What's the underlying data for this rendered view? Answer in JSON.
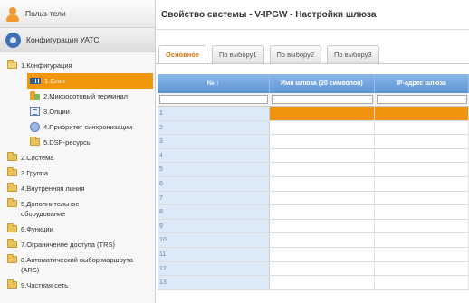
{
  "sidebar": {
    "top_users": "Польз-тели",
    "top_config": "Конфигурация УАТС",
    "tree": [
      {
        "label": "1.Конфигурация",
        "kind": "folder-open",
        "level": 0
      },
      {
        "label": "1.Слот",
        "kind": "slot",
        "level": 1,
        "selected": true
      },
      {
        "label": "2.Микросотовый терминал",
        "kind": "phone",
        "level": 1
      },
      {
        "label": "3.Опции",
        "kind": "options",
        "level": 1
      },
      {
        "label": "4.Приоритет синхронизации",
        "kind": "sync",
        "level": 1
      },
      {
        "label": "5.DSP-ресурсы",
        "kind": "folder",
        "level": 1
      },
      {
        "label": "2.Система",
        "kind": "folder",
        "level": 0
      },
      {
        "label": "3.Группа",
        "kind": "folder",
        "level": 0
      },
      {
        "label": "4.Внутренняя линия",
        "kind": "folder",
        "level": 0
      },
      {
        "label": "5.Дополнительное оборудование",
        "kind": "folder",
        "level": 0
      },
      {
        "label": "6.Функции",
        "kind": "folder",
        "level": 0
      },
      {
        "label": "7.Ограничение доступа (TRS)",
        "kind": "folder",
        "level": 0
      },
      {
        "label": "8.Автоматический выбор маршрута (ARS)",
        "kind": "folder",
        "level": 0
      },
      {
        "label": "9.Частная сеть",
        "kind": "folder",
        "level": 0
      }
    ]
  },
  "main": {
    "title": "Свойство системы - V-IPGW - Настройки шлюза",
    "tabs": [
      "Основное",
      "По выбору1",
      "По выбору2",
      "По выбору3"
    ],
    "active_tab": 0,
    "columns": [
      "№ ↑",
      "Имя шлюза (20 символов)",
      "IP-адрес шлюза"
    ],
    "rows": [
      "1",
      "2",
      "3",
      "4",
      "5",
      "6",
      "7",
      "8",
      "9",
      "10",
      "11",
      "12",
      "13"
    ]
  },
  "colors": {
    "accent": "#f2930f",
    "header_blue": "#5d93d4"
  }
}
